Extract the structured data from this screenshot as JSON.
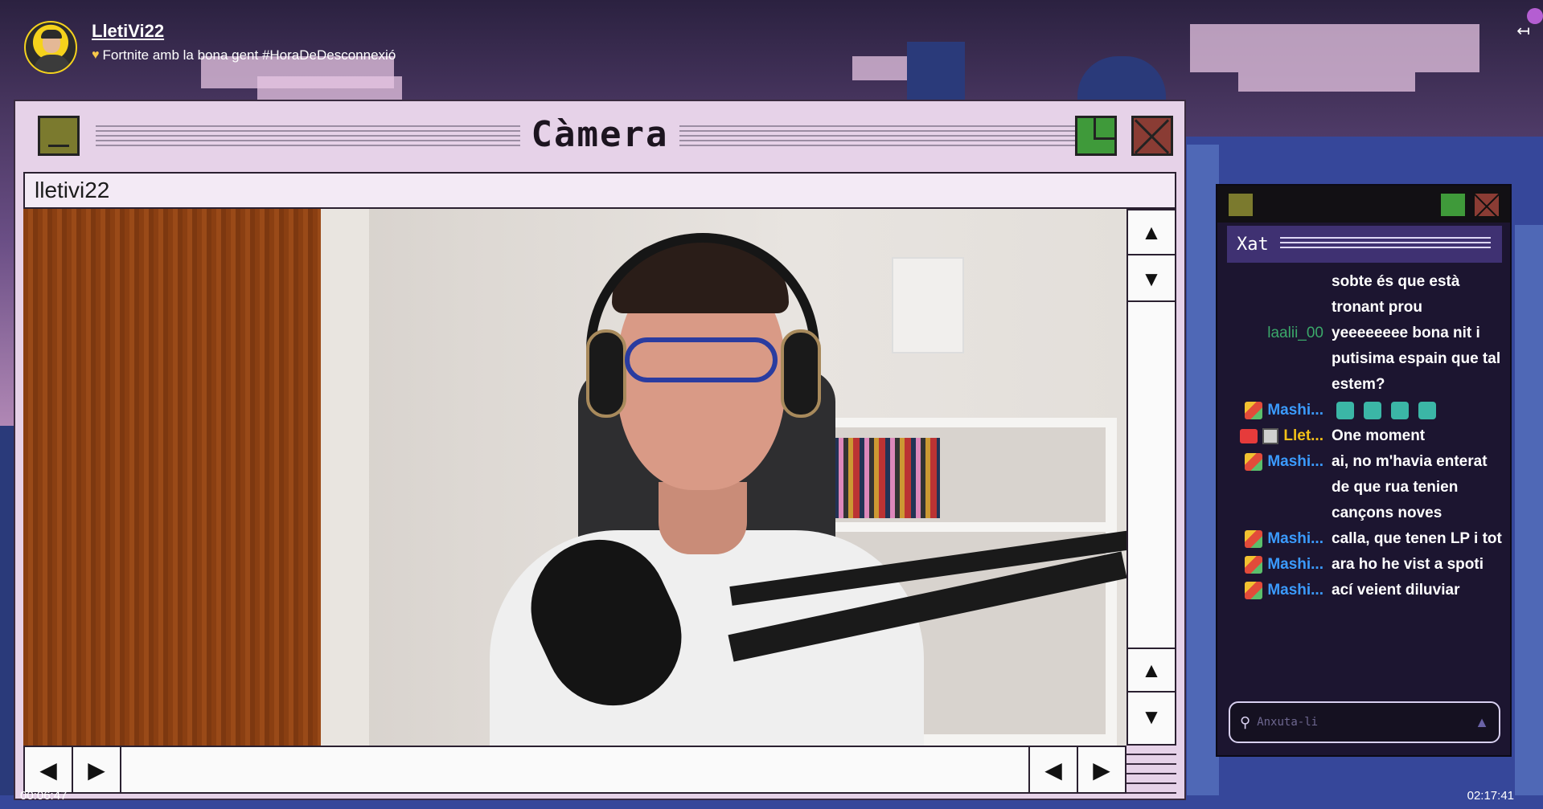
{
  "streamer": {
    "name": "LletiVi22",
    "title": "Fortnite amb la bona gent #HoraDeDesconnexió"
  },
  "camera_window": {
    "title": "Càmera",
    "address": "lletivi22"
  },
  "times": {
    "left": "00:06:47",
    "right": "02:17:41"
  },
  "chat": {
    "title": "Xat",
    "input_placeholder": "Anxuta-li",
    "messages": [
      {
        "user": "",
        "badges": [],
        "color": "",
        "text": "sobte és que està tronant prou"
      },
      {
        "user": "laalii_00",
        "badges": [],
        "color": "green",
        "text": "yeeeeeeee bona nit i putisima espain que tal estem?"
      },
      {
        "user": "Mashi...",
        "badges": [
          "rainbow"
        ],
        "color": "blue",
        "text": "",
        "emotes": 4
      },
      {
        "user": "Llet...",
        "badges": [
          "camera",
          "square"
        ],
        "color": "gold",
        "text": "One moment"
      },
      {
        "user": "Mashi...",
        "badges": [
          "rainbow"
        ],
        "color": "blue",
        "text": "ai, no m'havia enterat de que rua tenien cançons noves"
      },
      {
        "user": "Mashi...",
        "badges": [
          "rainbow"
        ],
        "color": "blue",
        "text": "calla, que tenen LP i tot"
      },
      {
        "user": "Mashi...",
        "badges": [
          "rainbow"
        ],
        "color": "blue",
        "text": "ara ho he vist a spoti"
      },
      {
        "user": "Mashi...",
        "badges": [
          "rainbow"
        ],
        "color": "blue",
        "text": "ací veient diluviar"
      }
    ]
  },
  "icons": {
    "collapse": "collapse-left-icon",
    "scroll_up": "triangle-up-icon",
    "scroll_down": "triangle-down-icon",
    "scroll_left": "triangle-left-icon",
    "scroll_right": "triangle-right-icon"
  }
}
